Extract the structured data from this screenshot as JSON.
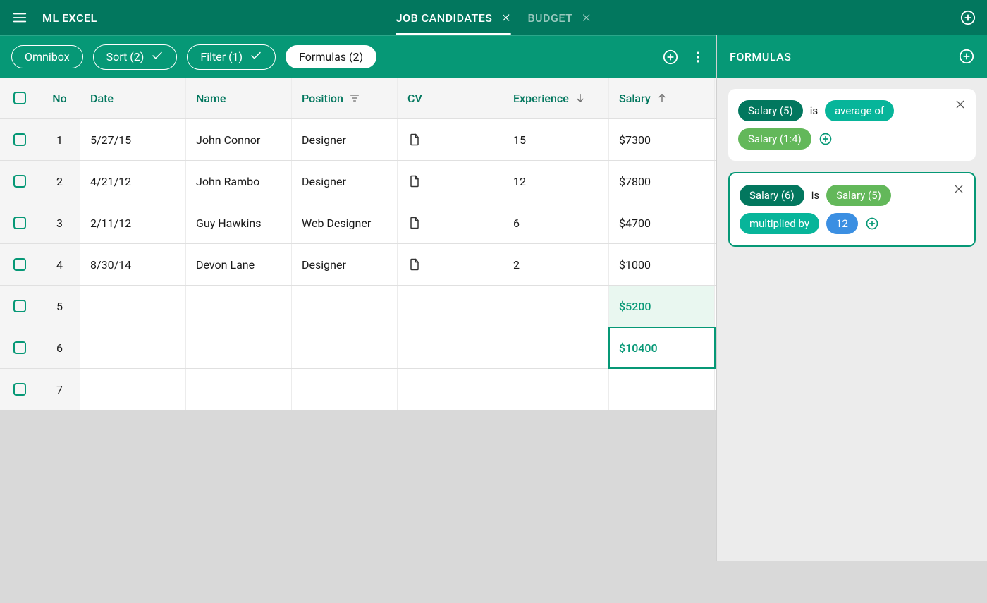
{
  "header": {
    "app_title": "ML EXCEL",
    "tabs": [
      {
        "label": "JOB CANDIDATES",
        "active": true
      },
      {
        "label": "BUDGET",
        "active": false
      }
    ]
  },
  "toolbar": {
    "omnibox": "Omnibox",
    "sort": "Sort (2)",
    "filter": "Filter (1)",
    "formulas": "Formulas (2)"
  },
  "table": {
    "columns": {
      "no": "No",
      "date": "Date",
      "name": "Name",
      "position": "Position",
      "cv": "CV",
      "experience": "Experience",
      "salary": "Salary"
    },
    "rows": [
      {
        "no": "1",
        "date": "5/27/15",
        "name": "John Connor",
        "position": "Designer",
        "cv": true,
        "experience": "15",
        "salary": "$7300"
      },
      {
        "no": "2",
        "date": "4/21/12",
        "name": "John Rambo",
        "position": "Designer",
        "cv": true,
        "experience": "12",
        "salary": "$7800"
      },
      {
        "no": "3",
        "date": "2/11/12",
        "name": "Guy Hawkins",
        "position": "Web Designer",
        "cv": true,
        "experience": "6",
        "salary": "$4700"
      },
      {
        "no": "4",
        "date": "8/30/14",
        "name": "Devon Lane",
        "position": "Designer",
        "cv": true,
        "experience": "2",
        "salary": "$1000"
      },
      {
        "no": "5",
        "date": "",
        "name": "",
        "position": "",
        "cv": false,
        "experience": "",
        "salary": "$5200",
        "calc": "light"
      },
      {
        "no": "6",
        "date": "",
        "name": "",
        "position": "",
        "cv": false,
        "experience": "",
        "salary": "$10400",
        "calc": "selected"
      },
      {
        "no": "7",
        "date": "",
        "name": "",
        "position": "",
        "cv": false,
        "experience": "",
        "salary": ""
      }
    ]
  },
  "side": {
    "title": "FORMULAS",
    "is_text": "is",
    "formulas": [
      {
        "active": false,
        "tokens": [
          {
            "text": "Salary (5)",
            "style": "dark-green"
          },
          {
            "text": "is",
            "style": "text"
          },
          {
            "text": "average of",
            "style": "teal"
          },
          {
            "text": "Salary (1:4)",
            "style": "light-green"
          }
        ]
      },
      {
        "active": true,
        "tokens": [
          {
            "text": "Salary (6)",
            "style": "dark-green"
          },
          {
            "text": "is",
            "style": "text"
          },
          {
            "text": "Salary (5)",
            "style": "light-green"
          },
          {
            "text": "multiplied by",
            "style": "teal"
          },
          {
            "text": "12",
            "style": "blue"
          }
        ]
      }
    ]
  }
}
